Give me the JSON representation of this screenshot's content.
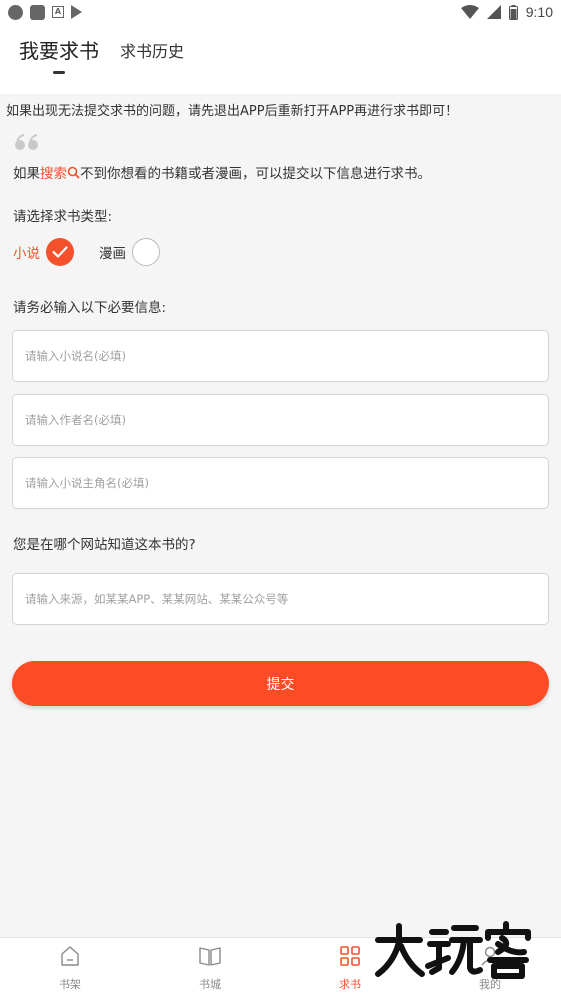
{
  "status_bar": {
    "time": "9:10",
    "left_icons": [
      "circle-notification-icon",
      "square-notification-icon",
      "a-notification-icon",
      "play-store-icon"
    ],
    "right_icons": [
      "wifi-icon",
      "signal-icon",
      "battery-icon"
    ]
  },
  "header": {
    "tabs": [
      {
        "label": "我要求书",
        "active": true
      },
      {
        "label": "求书历史",
        "active": false
      }
    ]
  },
  "notice": "如果出现无法提交求书的问题，请先退出APP后重新打开APP再进行求书即可！",
  "intro": {
    "prefix": "如果",
    "link": "搜索",
    "suffix": "不到你想看的书籍或者漫画，可以提交以下信息进行求书。"
  },
  "type_section": {
    "label": "请选择求书类型:",
    "options": [
      {
        "label": "小说",
        "selected": true
      },
      {
        "label": "漫画",
        "selected": false
      }
    ]
  },
  "required_section": {
    "label": "请务必输入以下必要信息:",
    "fields": [
      {
        "placeholder": "请输入小说名(必填)",
        "value": ""
      },
      {
        "placeholder": "请输入作者名(必填)",
        "value": ""
      },
      {
        "placeholder": "请输入小说主角名(必填)",
        "value": ""
      }
    ]
  },
  "source_section": {
    "label": "您是在哪个网站知道这本书的?",
    "field": {
      "placeholder": "请输入来源，如某某APP、某某网站、某某公众号等",
      "value": ""
    }
  },
  "submit_label": "提交",
  "tabbar": {
    "items": [
      {
        "label": "书架",
        "icon": "home-icon",
        "active": false
      },
      {
        "label": "书城",
        "icon": "book-icon",
        "active": false
      },
      {
        "label": "求书",
        "icon": "grid-icon",
        "active": true
      },
      {
        "label": "我的",
        "icon": "profile-icon",
        "active": false
      }
    ]
  },
  "watermark": "大玩家",
  "colors": {
    "accent": "#f4512c",
    "button": "#fb4c25",
    "background": "#f5f5f5"
  }
}
